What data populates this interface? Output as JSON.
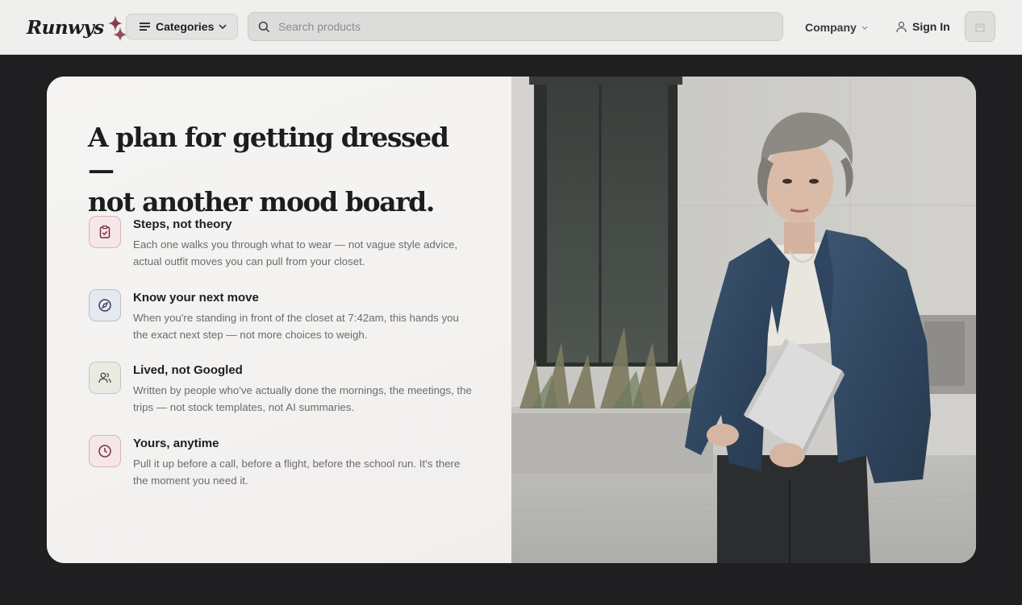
{
  "header": {
    "logo_text": "Runwys",
    "categories_label": "Categories",
    "search_placeholder": "Search products",
    "company_label": "Company",
    "signin_label": "Sign In"
  },
  "hero": {
    "headline_line1": "A plan for getting dressed —",
    "headline_line2": "not another mood board.",
    "features": [
      {
        "title": "Steps, not theory",
        "desc": "Each one walks you through what to wear — not vague style advice, actual outfit moves you can pull from your closet.",
        "icon": "clipboard-check-icon",
        "icon_bg": "#f4e6e9",
        "icon_border": "#d9b2ba",
        "icon_color": "#7a2f40"
      },
      {
        "title": "Know your next move",
        "desc": "When you're standing in front of the closet at 7:42am, this hands you the exact next step — not more choices to weigh.",
        "icon": "compass-icon",
        "icon_bg": "#e6e9ef",
        "icon_border": "#b8bfcc",
        "icon_color": "#34405a"
      },
      {
        "title": "Lived, not Googled",
        "desc": "Written by people who've actually done the mornings, the meetings, the trips — not stock templates, not AI summaries.",
        "icon": "users-icon",
        "icon_bg": "#e9ebe3",
        "icon_border": "#c4c8b6",
        "icon_color": "#4b5240"
      },
      {
        "title": "Yours, anytime",
        "desc": "Pull it up before a call, before a flight, before the school run. It's there the moment you need it.",
        "icon": "clock-icon",
        "icon_bg": "#f4e6e9",
        "icon_border": "#d9b2ba",
        "icon_color": "#7a2f40"
      }
    ]
  },
  "colors": {
    "brand_accent": "#7a2f40",
    "page_bg": "#1f1f21"
  }
}
